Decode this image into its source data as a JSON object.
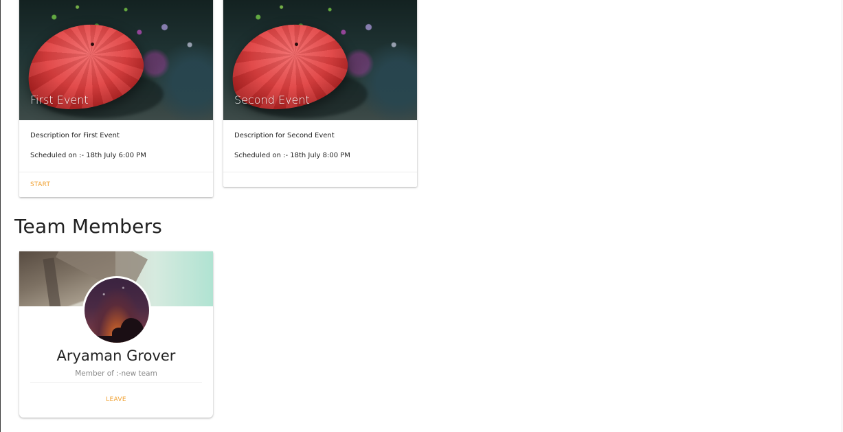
{
  "colors": {
    "accent": "#f0a030",
    "title_text": "#212121",
    "muted_text": "#888888",
    "card_bg": "#ffffff"
  },
  "events": [
    {
      "title": "First Event",
      "description": "Description for First Event",
      "schedule": "Scheduled on :- 18th July 6:00 PM",
      "action_label": "START",
      "image": "red-umbrella-photo"
    },
    {
      "title": "Second Event",
      "description": "Description for Second Event",
      "schedule": "Scheduled on :- 18th July 8:00 PM",
      "image": "red-umbrella-photo"
    }
  ],
  "team_section": {
    "title": "Team Members"
  },
  "members": [
    {
      "name": "Aryaman Grover",
      "subtitle": "Member of :-new team",
      "action_label": "LEAVE",
      "cover": "bridge-architecture-photo",
      "avatar": "sunset-silhouette-photo"
    }
  ]
}
